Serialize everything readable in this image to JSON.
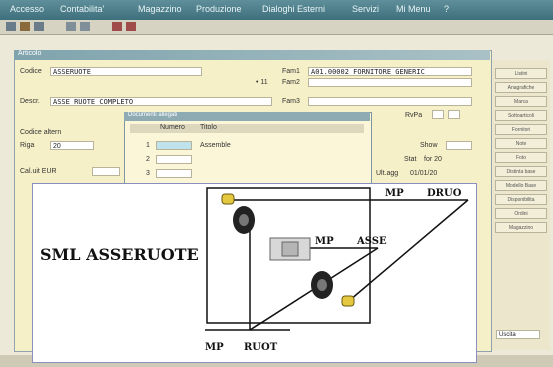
{
  "menubar": {
    "items": [
      "Accesso",
      "Contabilita'",
      "Magazzino",
      "Produzione",
      "Dialoghi Esterni",
      "Servizi",
      "Mi Menu",
      "?"
    ]
  },
  "window": {
    "title": "Articolo",
    "codice_label": "Codice",
    "codice_value": "ASSERUOTE",
    "descr_label": "Descr.",
    "descr_value": "ASSE RUOTE COMPLETO",
    "fam1_label": "Fam1",
    "fam1_value": "A01.00002 FORNITORE GENERIC",
    "fam2_label": "Fam2",
    "fam3_label": "Fam3",
    "mid_prefix": "• 11",
    "codice_altern_label": "Codice altern",
    "riga_label": "Riga",
    "riga_value": "20",
    "calc_label": "Cal.uit EUR",
    "rvpa_label": "RvPa",
    "show_label": "Show",
    "stat_label": "Stat",
    "stat_value": "for 20",
    "ult_agg_label": "Ult.agg",
    "ult_agg_value": "01/01/20",
    "bottom_button": "Uscita"
  },
  "popup": {
    "title": "Documenti allegati",
    "col_numero": "Numero",
    "col_titolo": "Titolo",
    "rows": [
      {
        "n": "1",
        "titolo": "Assemble"
      },
      {
        "n": "2",
        "titolo": ""
      },
      {
        "n": "3",
        "titolo": ""
      }
    ]
  },
  "right_panel": {
    "buttons": [
      "Listini",
      "Anagrafiche",
      "Marca",
      "Sottoarticoli",
      "Fornitori",
      "Note",
      "Foto",
      "Distinta base",
      "Modello Base",
      "Disponibilita",
      "Ordini",
      "Magazzino"
    ]
  },
  "overlay": {
    "title": "SML ASSERUOTE",
    "labels": {
      "mp1": "MP",
      "druo": "DRUO",
      "mp2": "MP",
      "asse": "ASSE",
      "mp3": "MP",
      "ruot": "RUOT"
    }
  }
}
